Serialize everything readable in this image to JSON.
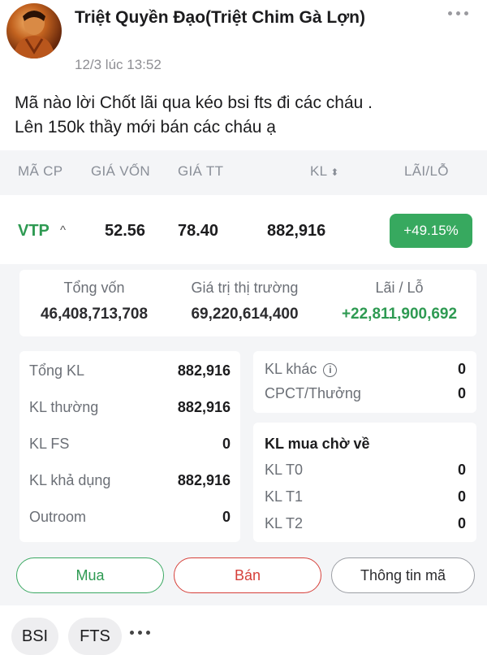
{
  "post": {
    "author": "Triệt Quyền Đạo(Triệt Chim Gà Lợn)",
    "timestamp": "12/3 lúc 13:52",
    "text_line1": "Mã nào lời Chốt lãi qua kéo bsi fts đi các cháu .",
    "text_line2": "Lên 150k thầy mới bán các cháu ạ",
    "avatar_icon": "profile-photo",
    "more_icon": "more-horizontal-icon"
  },
  "table_header": {
    "symbol": "MÃ CP",
    "cost_price": "GIÁ VỐN",
    "market_price": "GIÁ TT",
    "volume": "KL",
    "volume_sort_icon": "sort-icon",
    "profit_loss": "LÃI/LỖ"
  },
  "position": {
    "symbol": "VTP",
    "expand_icon": "chevron-up-icon",
    "cost_price": "52.56",
    "market_price": "78.40",
    "volume": "882,916",
    "profit_pct": "+49.15%"
  },
  "summary": {
    "total_capital_label": "Tổng vốn",
    "total_capital": "46,408,713,708",
    "market_value_label": "Giá trị thị trường",
    "market_value": "69,220,614,400",
    "profit_label": "Lãi / Lỗ",
    "profit": "+22,811,900,692"
  },
  "details_left": [
    {
      "label": "Tổng KL",
      "value": "882,916"
    },
    {
      "label": "KL thường",
      "value": "882,916"
    },
    {
      "label": "KL FS",
      "value": "0"
    },
    {
      "label": "KL khả dụng",
      "value": "882,916"
    },
    {
      "label": "Outroom",
      "value": "0"
    }
  ],
  "details_right_top": [
    {
      "label": "KL khác",
      "value": "0",
      "icon": "info-icon"
    },
    {
      "label": "CPCT/Thưởng",
      "value": "0"
    }
  ],
  "pending": {
    "title": "KL mua chờ về",
    "rows": [
      {
        "label": "KL T0",
        "value": "0"
      },
      {
        "label": "KL T1",
        "value": "0"
      },
      {
        "label": "KL T2",
        "value": "0"
      }
    ]
  },
  "actions": {
    "buy": "Mua",
    "sell": "Bán",
    "info": "Thông tin mã"
  },
  "tags": [
    "BSI",
    "FTS"
  ],
  "colors": {
    "positive": "#2e9a52",
    "buy_border": "#3aa862",
    "sell_border": "#d6403a",
    "pill": "#37a95f"
  }
}
